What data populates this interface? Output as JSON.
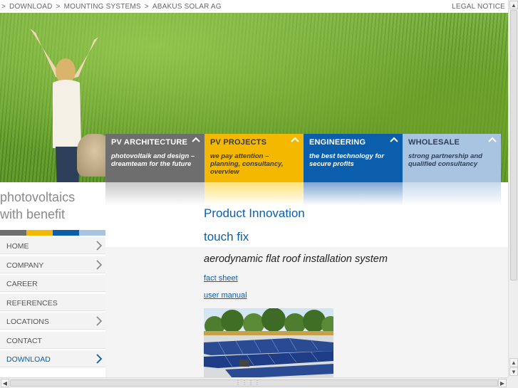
{
  "breadcrumb": {
    "items": [
      "DOWNLOAD",
      "MOUNTING SYSTEMS",
      "ABAKUS SOLAR AG"
    ],
    "separator": ">"
  },
  "header": {
    "legal_notice": "LEGAL NOTICE"
  },
  "tiles": [
    {
      "title": "PV ARCHITECTURE",
      "subtitle": "photovoltaik and design – dreamteam for the future",
      "color": "#6e6e6e"
    },
    {
      "title": "PV PROJECTS",
      "subtitle": "we pay attention – planning, consultancy, overview",
      "color": "#f5b800"
    },
    {
      "title": "ENGINEERING",
      "subtitle": "the best technology for secure profits",
      "color": "#0b5eab"
    },
    {
      "title": "WHOLESALE",
      "subtitle": "strong partnership and qualified consultancy",
      "color": "#a9c4e0"
    }
  ],
  "sidebar": {
    "tagline_line1": "photovoltaics",
    "tagline_line2": "with benefit",
    "color_bar": [
      "#6e6e6e",
      "#f5b800",
      "#0b5eab",
      "#a9c4e0"
    ],
    "items": [
      {
        "label": "HOME",
        "has_chevron": true
      },
      {
        "label": "COMPANY",
        "has_chevron": true
      },
      {
        "label": "CAREER",
        "has_chevron": false
      },
      {
        "label": "REFERENCES",
        "has_chevron": false
      },
      {
        "label": "LOCATIONS",
        "has_chevron": true
      },
      {
        "label": "CONTACT",
        "has_chevron": false
      },
      {
        "label": "DOWNLOAD",
        "has_chevron": true,
        "active": true
      }
    ]
  },
  "main": {
    "heading": "Product Innovation",
    "product_name": "touch fix",
    "tagline": "aerodynamic flat roof installation system",
    "links": [
      "fact sheet",
      "user manual"
    ]
  },
  "colors": {
    "brand_blue": "#0b5eab",
    "brand_yellow": "#f5b800",
    "brand_grey": "#6e6e6e",
    "brand_light_blue": "#a9c4e0"
  }
}
